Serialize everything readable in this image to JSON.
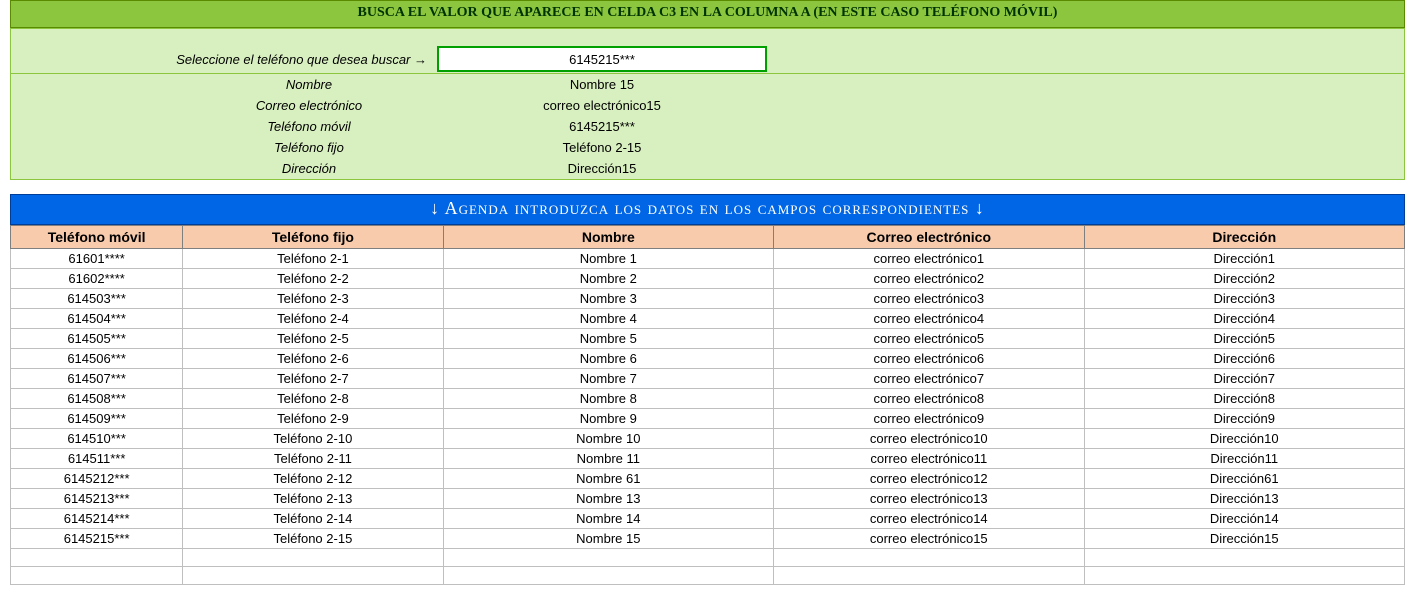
{
  "title_bar": "BUSCA EL VALOR  QUE APARECE EN  CELDA C3 EN LA COLUMNA A  (EN ESTE CASO TELÉFONO MÓVIL)",
  "search": {
    "label": "Seleccione el teléfono  que desea buscar  →",
    "value": "6145215***"
  },
  "lookup": {
    "rows": [
      {
        "label": "Nombre",
        "value": "Nombre 15"
      },
      {
        "label": "Correo electrónico",
        "value": "correo electrónico15"
      },
      {
        "label": "Teléfono móvil",
        "value": "6145215***"
      },
      {
        "label": "Teléfono fijo",
        "value": "Teléfono 2-15"
      },
      {
        "label": "Dirección",
        "value": "Dirección15"
      }
    ]
  },
  "agenda_bar": "↓     Agenda  introduzca los datos en los campos correspondientes   ↓",
  "table": {
    "headers": [
      "Teléfono móvil",
      "Teléfono fijo",
      "Nombre",
      "Correo electrónico",
      "Dirección"
    ],
    "rows": [
      [
        "61601****",
        "Teléfono 2-1",
        "Nombre 1",
        "correo electrónico1",
        "Dirección1"
      ],
      [
        "61602****",
        "Teléfono 2-2",
        "Nombre 2",
        "correo electrónico2",
        "Dirección2"
      ],
      [
        "614503***",
        "Teléfono 2-3",
        "Nombre 3",
        "correo electrónico3",
        "Dirección3"
      ],
      [
        "614504***",
        "Teléfono 2-4",
        "Nombre 4",
        "correo electrónico4",
        "Dirección4"
      ],
      [
        "614505***",
        "Teléfono 2-5",
        "Nombre 5",
        "correo electrónico5",
        "Dirección5"
      ],
      [
        "614506***",
        "Teléfono 2-6",
        "Nombre 6",
        "correo electrónico6",
        "Dirección6"
      ],
      [
        "614507***",
        "Teléfono 2-7",
        "Nombre 7",
        "correo electrónico7",
        "Dirección7"
      ],
      [
        "614508***",
        "Teléfono 2-8",
        "Nombre 8",
        "correo electrónico8",
        "Dirección8"
      ],
      [
        "614509***",
        "Teléfono 2-9",
        "Nombre 9",
        "correo electrónico9",
        "Dirección9"
      ],
      [
        "614510***",
        "Teléfono 2-10",
        "Nombre 10",
        "correo electrónico10",
        "Dirección10"
      ],
      [
        "614511***",
        "Teléfono 2-11",
        "Nombre 11",
        "correo electrónico11",
        "Dirección11"
      ],
      [
        "6145212***",
        "Teléfono 2-12",
        "Nombre 61",
        "correo electrónico12",
        "Dirección61"
      ],
      [
        "6145213***",
        "Teléfono 2-13",
        "Nombre 13",
        "correo electrónico13",
        "Dirección13"
      ],
      [
        "6145214***",
        "Teléfono 2-14",
        "Nombre 14",
        "correo electrónico14",
        "Dirección14"
      ],
      [
        "6145215***",
        "Teléfono 2-15",
        "Nombre 15",
        "correo electrónico15",
        "Dirección15"
      ],
      [
        "",
        "",
        "",
        "",
        ""
      ],
      [
        "",
        "",
        "",
        "",
        ""
      ]
    ]
  }
}
